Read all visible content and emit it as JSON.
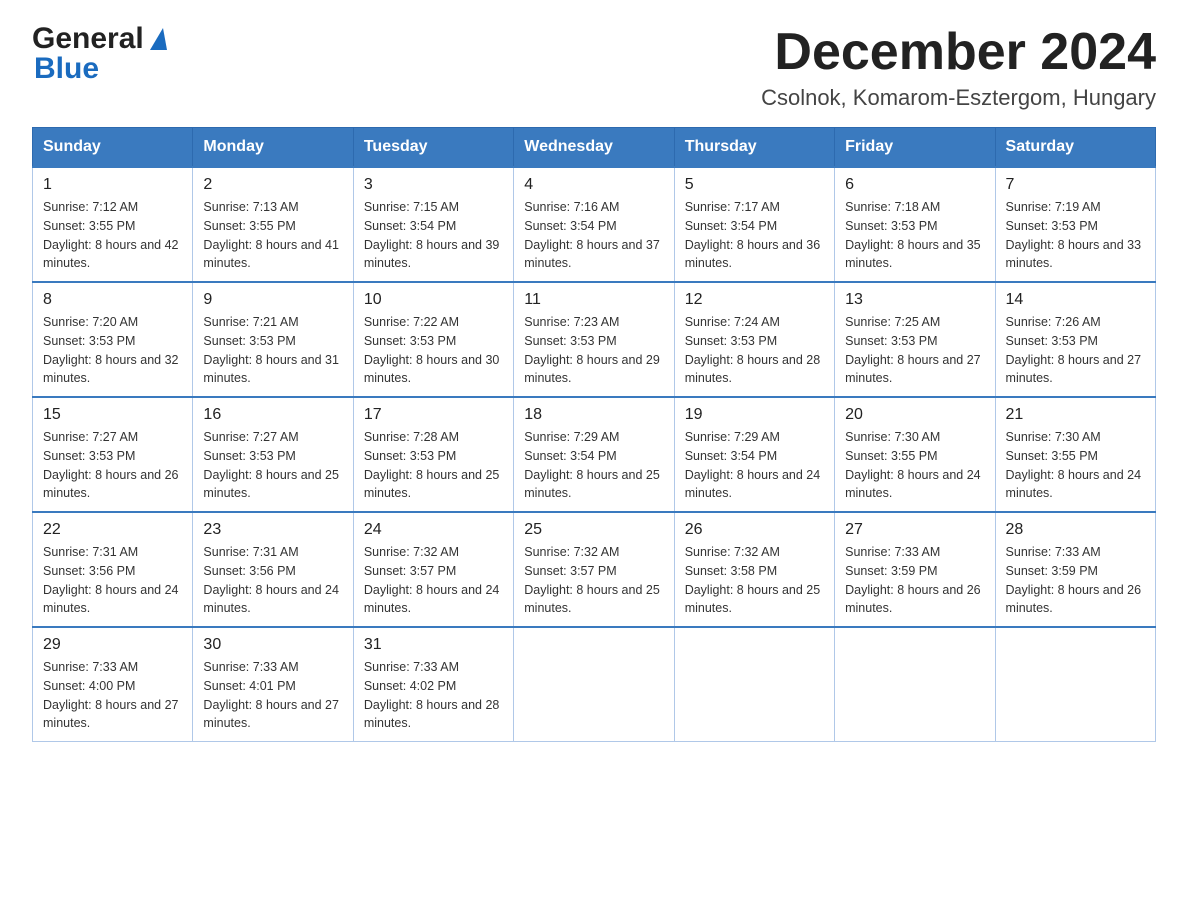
{
  "logo": {
    "general_text": "General",
    "blue_text": "Blue"
  },
  "title": "December 2024",
  "location": "Csolnok, Komarom-Esztergom, Hungary",
  "days_of_week": [
    "Sunday",
    "Monday",
    "Tuesday",
    "Wednesday",
    "Thursday",
    "Friday",
    "Saturday"
  ],
  "weeks": [
    [
      {
        "day": "1",
        "sunrise": "7:12 AM",
        "sunset": "3:55 PM",
        "daylight": "8 hours and 42 minutes."
      },
      {
        "day": "2",
        "sunrise": "7:13 AM",
        "sunset": "3:55 PM",
        "daylight": "8 hours and 41 minutes."
      },
      {
        "day": "3",
        "sunrise": "7:15 AM",
        "sunset": "3:54 PM",
        "daylight": "8 hours and 39 minutes."
      },
      {
        "day": "4",
        "sunrise": "7:16 AM",
        "sunset": "3:54 PM",
        "daylight": "8 hours and 37 minutes."
      },
      {
        "day": "5",
        "sunrise": "7:17 AM",
        "sunset": "3:54 PM",
        "daylight": "8 hours and 36 minutes."
      },
      {
        "day": "6",
        "sunrise": "7:18 AM",
        "sunset": "3:53 PM",
        "daylight": "8 hours and 35 minutes."
      },
      {
        "day": "7",
        "sunrise": "7:19 AM",
        "sunset": "3:53 PM",
        "daylight": "8 hours and 33 minutes."
      }
    ],
    [
      {
        "day": "8",
        "sunrise": "7:20 AM",
        "sunset": "3:53 PM",
        "daylight": "8 hours and 32 minutes."
      },
      {
        "day": "9",
        "sunrise": "7:21 AM",
        "sunset": "3:53 PM",
        "daylight": "8 hours and 31 minutes."
      },
      {
        "day": "10",
        "sunrise": "7:22 AM",
        "sunset": "3:53 PM",
        "daylight": "8 hours and 30 minutes."
      },
      {
        "day": "11",
        "sunrise": "7:23 AM",
        "sunset": "3:53 PM",
        "daylight": "8 hours and 29 minutes."
      },
      {
        "day": "12",
        "sunrise": "7:24 AM",
        "sunset": "3:53 PM",
        "daylight": "8 hours and 28 minutes."
      },
      {
        "day": "13",
        "sunrise": "7:25 AM",
        "sunset": "3:53 PM",
        "daylight": "8 hours and 27 minutes."
      },
      {
        "day": "14",
        "sunrise": "7:26 AM",
        "sunset": "3:53 PM",
        "daylight": "8 hours and 27 minutes."
      }
    ],
    [
      {
        "day": "15",
        "sunrise": "7:27 AM",
        "sunset": "3:53 PM",
        "daylight": "8 hours and 26 minutes."
      },
      {
        "day": "16",
        "sunrise": "7:27 AM",
        "sunset": "3:53 PM",
        "daylight": "8 hours and 25 minutes."
      },
      {
        "day": "17",
        "sunrise": "7:28 AM",
        "sunset": "3:53 PM",
        "daylight": "8 hours and 25 minutes."
      },
      {
        "day": "18",
        "sunrise": "7:29 AM",
        "sunset": "3:54 PM",
        "daylight": "8 hours and 25 minutes."
      },
      {
        "day": "19",
        "sunrise": "7:29 AM",
        "sunset": "3:54 PM",
        "daylight": "8 hours and 24 minutes."
      },
      {
        "day": "20",
        "sunrise": "7:30 AM",
        "sunset": "3:55 PM",
        "daylight": "8 hours and 24 minutes."
      },
      {
        "day": "21",
        "sunrise": "7:30 AM",
        "sunset": "3:55 PM",
        "daylight": "8 hours and 24 minutes."
      }
    ],
    [
      {
        "day": "22",
        "sunrise": "7:31 AM",
        "sunset": "3:56 PM",
        "daylight": "8 hours and 24 minutes."
      },
      {
        "day": "23",
        "sunrise": "7:31 AM",
        "sunset": "3:56 PM",
        "daylight": "8 hours and 24 minutes."
      },
      {
        "day": "24",
        "sunrise": "7:32 AM",
        "sunset": "3:57 PM",
        "daylight": "8 hours and 24 minutes."
      },
      {
        "day": "25",
        "sunrise": "7:32 AM",
        "sunset": "3:57 PM",
        "daylight": "8 hours and 25 minutes."
      },
      {
        "day": "26",
        "sunrise": "7:32 AM",
        "sunset": "3:58 PM",
        "daylight": "8 hours and 25 minutes."
      },
      {
        "day": "27",
        "sunrise": "7:33 AM",
        "sunset": "3:59 PM",
        "daylight": "8 hours and 26 minutes."
      },
      {
        "day": "28",
        "sunrise": "7:33 AM",
        "sunset": "3:59 PM",
        "daylight": "8 hours and 26 minutes."
      }
    ],
    [
      {
        "day": "29",
        "sunrise": "7:33 AM",
        "sunset": "4:00 PM",
        "daylight": "8 hours and 27 minutes."
      },
      {
        "day": "30",
        "sunrise": "7:33 AM",
        "sunset": "4:01 PM",
        "daylight": "8 hours and 27 minutes."
      },
      {
        "day": "31",
        "sunrise": "7:33 AM",
        "sunset": "4:02 PM",
        "daylight": "8 hours and 28 minutes."
      },
      null,
      null,
      null,
      null
    ]
  ],
  "labels": {
    "sunrise": "Sunrise: ",
    "sunset": "Sunset: ",
    "daylight": "Daylight: "
  }
}
